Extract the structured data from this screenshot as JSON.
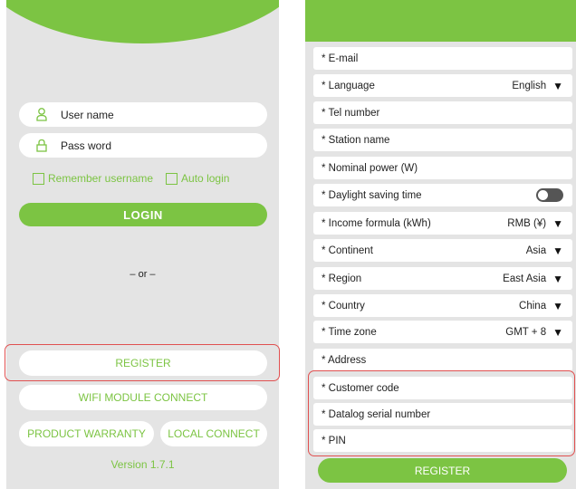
{
  "login": {
    "username_placeholder": "User name",
    "password_placeholder": "Pass word",
    "remember_label": "Remember username",
    "auto_login_label": "Auto login",
    "login_button": "LOGIN",
    "or_text": "– or –",
    "register_button": "REGISTER",
    "wifi_button": "WIFI MODULE CONNECT",
    "warranty_button": "PRODUCT WARRANTY",
    "local_button": "LOCAL CONNECT",
    "version": "Version 1.7.1"
  },
  "register_form": {
    "fields": [
      {
        "label": "* E-mail",
        "value": ""
      },
      {
        "label": "* Language",
        "value": "English"
      },
      {
        "label": "* Tel number",
        "value": ""
      },
      {
        "label": "* Station name",
        "value": ""
      },
      {
        "label": "* Nominal power (W)",
        "value": ""
      },
      {
        "label": "* Daylight saving time",
        "value": ""
      },
      {
        "label": "* Income formula (kWh)",
        "value": "RMB (¥)"
      },
      {
        "label": "* Continent",
        "value": "Asia"
      },
      {
        "label": "* Region",
        "value": "East Asia"
      },
      {
        "label": "* Country",
        "value": "China"
      },
      {
        "label": "* Time zone",
        "value": "GMT + 8"
      },
      {
        "label": "* Address",
        "value": ""
      },
      {
        "label": "* Customer code",
        "value": ""
      },
      {
        "label": "* Datalog serial number",
        "value": ""
      },
      {
        "label": "* PIN",
        "value": ""
      }
    ],
    "register_button": "REGISTER"
  },
  "colors": {
    "accent": "#7cc443",
    "panel_bg": "#e4e4e4",
    "highlight": "#e05050"
  },
  "icons": {
    "user": "user-icon",
    "lock": "lock-icon",
    "dropdown": "triangle-down-icon"
  }
}
